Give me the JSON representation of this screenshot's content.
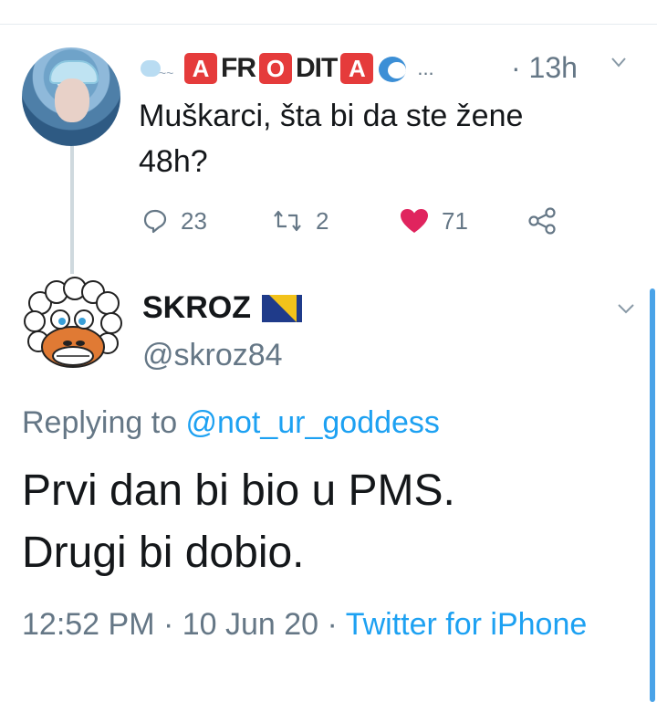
{
  "tweet1": {
    "display_name_tiles": [
      "A",
      "FR",
      "O",
      "DIT",
      "A"
    ],
    "name_overflow": "...",
    "time": "· 13h",
    "text_line1": "Muškarci, šta bi da ste žene",
    "text_line2": "48h?",
    "actions": {
      "replies": "23",
      "retweets": "2",
      "likes": "71"
    },
    "colors": {
      "like": "#e0245e",
      "tile": "#e53b3b",
      "muted": "#657786"
    }
  },
  "tweet2": {
    "display_name": "SKROZ",
    "handle": "@skroz84",
    "replying_prefix": "Replying to ",
    "replying_handle": "@not_ur_goddess",
    "text_line1": "Prvi dan bi bio u PMS.",
    "text_line2": "Drugi bi dobio.",
    "timestamp": "12:52 PM · 10 Jun 20 · ",
    "source": "Twitter for iPhone",
    "colors": {
      "link": "#1da1f2"
    }
  },
  "icons": [
    "reply-icon",
    "retweet-icon",
    "heart-icon",
    "share-icon",
    "chevron-down-icon",
    "flag-icon"
  ]
}
